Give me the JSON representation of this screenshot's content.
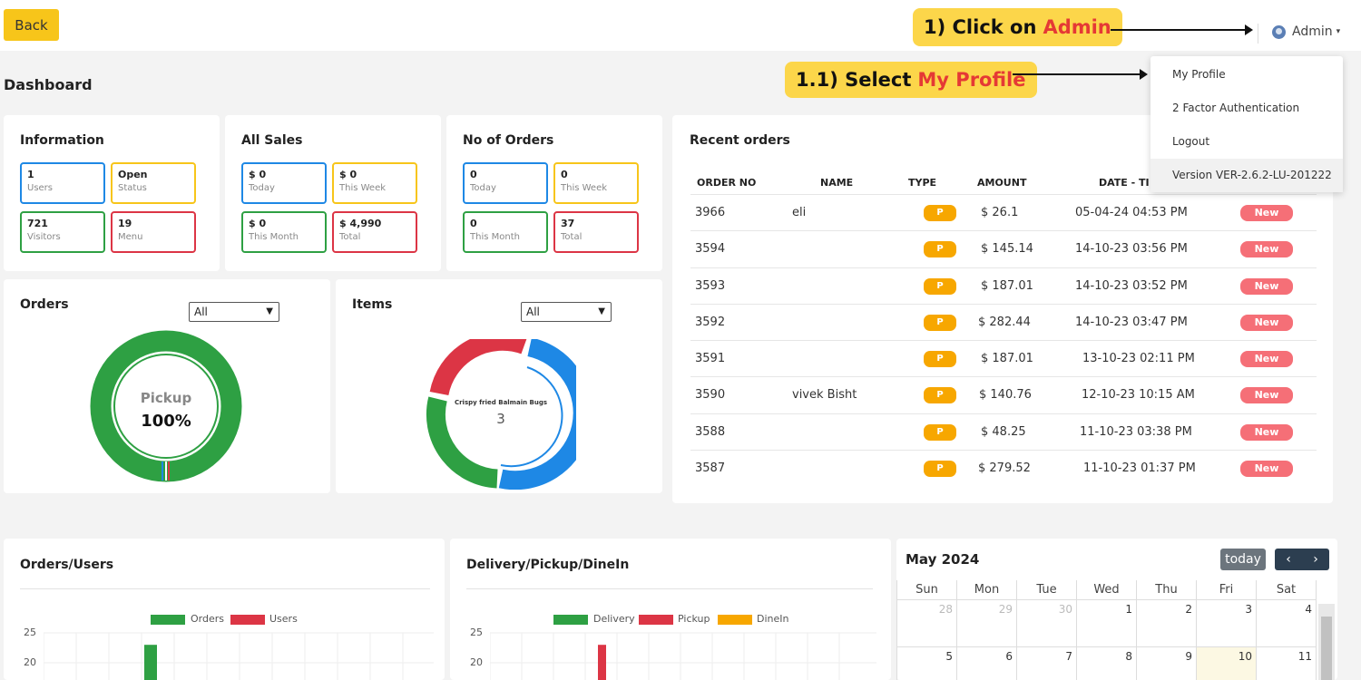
{
  "topbar": {
    "back_label": "Back",
    "admin_label": "Admin",
    "admin_caret": "▾"
  },
  "callouts": {
    "step1_prefix": "1) Click on",
    "step1_highlight": "Admin",
    "step2_prefix": "1.1) Select",
    "step2_highlight": "My Profile"
  },
  "admin_menu": [
    "My Profile",
    "2 Factor Authentication",
    "Logout",
    "Version VER-2.6.2-LU-201222"
  ],
  "page_title": "Dashboard",
  "information": {
    "title": "Information",
    "stats": [
      {
        "value": "1",
        "label": "Users"
      },
      {
        "value": "Open",
        "label": "Status"
      },
      {
        "value": "721",
        "label": "Visitors"
      },
      {
        "value": "19",
        "label": "Menu"
      }
    ]
  },
  "all_sales": {
    "title": "All Sales",
    "stats": [
      {
        "value": "$ 0",
        "label": "Today"
      },
      {
        "value": "$ 0",
        "label": "This Week"
      },
      {
        "value": "$ 0",
        "label": "This Month"
      },
      {
        "value": "$ 4,990",
        "label": "Total"
      }
    ]
  },
  "no_of_orders": {
    "title": "No of Orders",
    "stats": [
      {
        "value": "0",
        "label": "Today"
      },
      {
        "value": "0",
        "label": "This Week"
      },
      {
        "value": "0",
        "label": "This Month"
      },
      {
        "value": "37",
        "label": "Total"
      }
    ]
  },
  "orders_card": {
    "title": "Orders",
    "select_value": "All",
    "center_label": "Pickup",
    "center_value": "100%",
    "colors": {
      "pickup": "#2ea043",
      "delivery": "#1e88e5",
      "dinein": "#dc3545"
    }
  },
  "items_card": {
    "title": "Items",
    "select_value": "All",
    "center_label": "Crispy fried Balmain Bugs",
    "center_value": "3",
    "colors": {
      "blue": "#1e88e5",
      "red": "#dc3545",
      "green": "#2ea043"
    }
  },
  "recent_orders": {
    "title": "Recent orders",
    "columns": [
      "ORDER NO",
      "NAME",
      "TYPE",
      "AMOUNT",
      "DATE - TI"
    ],
    "rows": [
      {
        "order_no": "3966",
        "name": "eli",
        "type": "P",
        "amount": "$ 26.1",
        "date": "05-04-24 04:53 PM",
        "status": "New"
      },
      {
        "order_no": "3594",
        "name": "",
        "type": "P",
        "amount": "$ 145.14",
        "date": "14-10-23 03:56 PM",
        "status": "New"
      },
      {
        "order_no": "3593",
        "name": "",
        "type": "P",
        "amount": "$ 187.01",
        "date": "14-10-23 03:52 PM",
        "status": "New"
      },
      {
        "order_no": "3592",
        "name": "",
        "type": "P",
        "amount": "$ 282.44",
        "date": "14-10-23 03:47 PM",
        "status": "New"
      },
      {
        "order_no": "3591",
        "name": "",
        "type": "P",
        "amount": "$ 187.01",
        "date": "13-10-23 02:11 PM",
        "status": "New"
      },
      {
        "order_no": "3590",
        "name": "vivek Bisht",
        "type": "P",
        "amount": "$ 140.76",
        "date": "12-10-23 10:15 AM",
        "status": "New"
      },
      {
        "order_no": "3588",
        "name": "",
        "type": "P",
        "amount": "$ 48.25",
        "date": "11-10-23 03:38 PM",
        "status": "New"
      },
      {
        "order_no": "3587",
        "name": "",
        "type": "P",
        "amount": "$ 279.52",
        "date": "11-10-23 01:37 PM",
        "status": "New"
      }
    ]
  },
  "orders_users_chart": {
    "title": "Orders/Users",
    "legend": [
      {
        "label": "Orders",
        "color": "#2ea043"
      },
      {
        "label": "Users",
        "color": "#dc3545"
      }
    ],
    "y_ticks": [
      "25",
      "20"
    ]
  },
  "dpd_chart": {
    "title": "Delivery/Pickup/DineIn",
    "legend": [
      {
        "label": "Delivery",
        "color": "#2ea043"
      },
      {
        "label": "Pickup",
        "color": "#dc3545"
      },
      {
        "label": "DineIn",
        "color": "#f7a700"
      }
    ],
    "y_ticks": [
      "25",
      "20"
    ]
  },
  "calendar": {
    "month_label": "May 2024",
    "today_label": "today",
    "prev_icon": "‹",
    "next_icon": "›",
    "day_names": [
      "Sun",
      "Mon",
      "Tue",
      "Wed",
      "Thu",
      "Fri",
      "Sat"
    ],
    "week1": [
      "28",
      "29",
      "30",
      "1",
      "2",
      "3",
      "4"
    ],
    "week2": [
      "5",
      "6",
      "7",
      "8",
      "9",
      "10",
      "11"
    ]
  },
  "chart_data": [
    {
      "type": "pie",
      "title": "Orders",
      "categories": [
        "Pickup",
        "Delivery",
        "DineIn"
      ],
      "values": [
        100,
        0,
        0
      ]
    },
    {
      "type": "pie",
      "title": "Items",
      "categories": [
        "Blue",
        "Red",
        "Green"
      ],
      "values": [
        3,
        2,
        2
      ]
    },
    {
      "type": "bar",
      "title": "Orders/Users",
      "series": [
        {
          "name": "Orders",
          "values": [
            23
          ]
        },
        {
          "name": "Users",
          "values": [
            0
          ]
        }
      ],
      "ylim": [
        0,
        25
      ]
    },
    {
      "type": "bar",
      "title": "Delivery/Pickup/DineIn",
      "series": [
        {
          "name": "Delivery",
          "values": [
            0
          ]
        },
        {
          "name": "Pickup",
          "values": [
            23
          ]
        },
        {
          "name": "DineIn",
          "values": [
            0
          ]
        }
      ],
      "ylim": [
        0,
        25
      ]
    }
  ]
}
